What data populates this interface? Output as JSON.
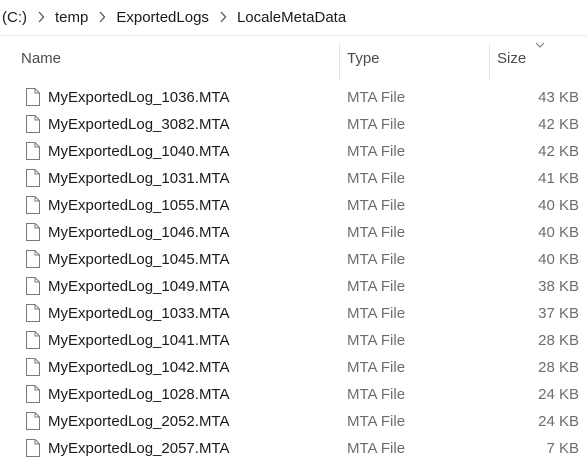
{
  "breadcrumb": {
    "items": [
      "(C:)",
      "temp",
      "ExportedLogs",
      "LocaleMetaData"
    ]
  },
  "columns": {
    "name": "Name",
    "type": "Type",
    "size": "Size",
    "sort_indicator_icon": "chevron-down-icon"
  },
  "files": [
    {
      "name": "MyExportedLog_1036.MTA",
      "type": "MTA File",
      "size": "43 KB"
    },
    {
      "name": "MyExportedLog_3082.MTA",
      "type": "MTA File",
      "size": "42 KB"
    },
    {
      "name": "MyExportedLog_1040.MTA",
      "type": "MTA File",
      "size": "42 KB"
    },
    {
      "name": "MyExportedLog_1031.MTA",
      "type": "MTA File",
      "size": "41 KB"
    },
    {
      "name": "MyExportedLog_1055.MTA",
      "type": "MTA File",
      "size": "40 KB"
    },
    {
      "name": "MyExportedLog_1046.MTA",
      "type": "MTA File",
      "size": "40 KB"
    },
    {
      "name": "MyExportedLog_1045.MTA",
      "type": "MTA File",
      "size": "40 KB"
    },
    {
      "name": "MyExportedLog_1049.MTA",
      "type": "MTA File",
      "size": "38 KB"
    },
    {
      "name": "MyExportedLog_1033.MTA",
      "type": "MTA File",
      "size": "37 KB"
    },
    {
      "name": "MyExportedLog_1041.MTA",
      "type": "MTA File",
      "size": "28 KB"
    },
    {
      "name": "MyExportedLog_1042.MTA",
      "type": "MTA File",
      "size": "28 KB"
    },
    {
      "name": "MyExportedLog_1028.MTA",
      "type": "MTA File",
      "size": "24 KB"
    },
    {
      "name": "MyExportedLog_2052.MTA",
      "type": "MTA File",
      "size": "24 KB"
    },
    {
      "name": "MyExportedLog_2057.MTA",
      "type": "MTA File",
      "size": "7 KB"
    }
  ]
}
